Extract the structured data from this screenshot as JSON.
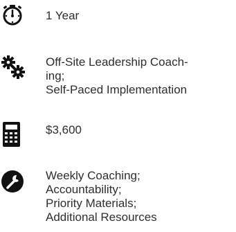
{
  "features": {
    "term": {
      "icon": "stopwatch-icon",
      "lines": [
        "1 Year"
      ]
    },
    "delivery": {
      "icon": "gears-icon",
      "lines": [
        "Off-Site Leadership Coach-",
        "ing;",
        "Self-Paced Implementation"
      ]
    },
    "price": {
      "icon": "calculator-icon",
      "lines": [
        "$3,600"
      ]
    },
    "includes": {
      "icon": "wrench-icon",
      "lines": [
        "Weekly Coaching;",
        "Accountability;",
        "Priority Materials;",
        "Additional Resources"
      ]
    }
  },
  "colors": {
    "icon": "#111111",
    "text": "#2e2e2e"
  }
}
